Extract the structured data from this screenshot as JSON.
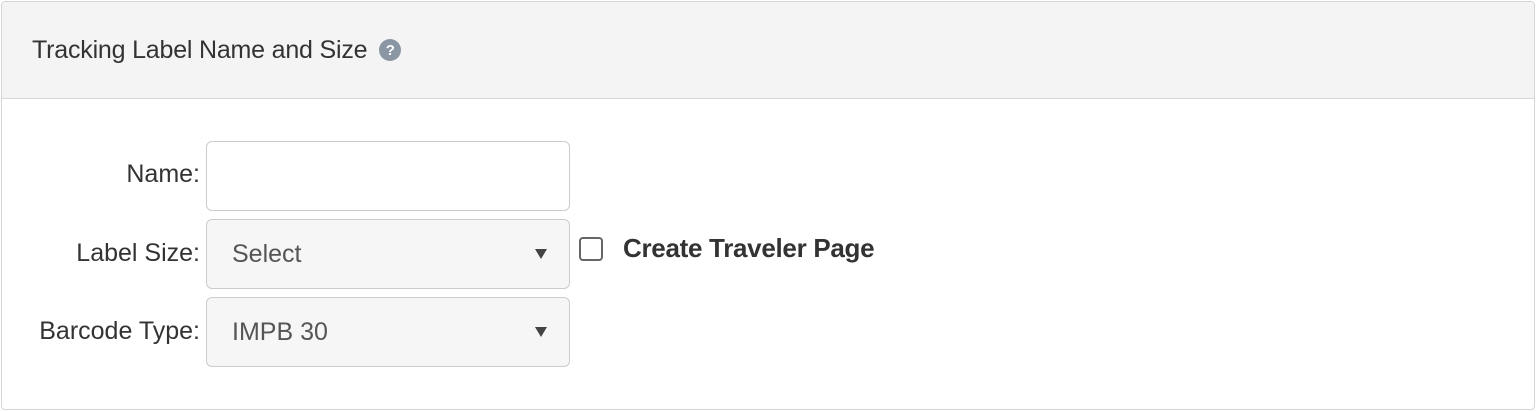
{
  "panel": {
    "title": "Tracking Label Name and Size",
    "help_icon": "question-circle-icon"
  },
  "form": {
    "name": {
      "label": "Name:",
      "value": "",
      "placeholder": ""
    },
    "label_size": {
      "label": "Label Size:",
      "selected": "Select"
    },
    "create_traveler_page": {
      "label": "Create Traveler Page",
      "checked": false
    },
    "barcode_type": {
      "label": "Barcode Type:",
      "selected": "IMPB 30"
    }
  }
}
